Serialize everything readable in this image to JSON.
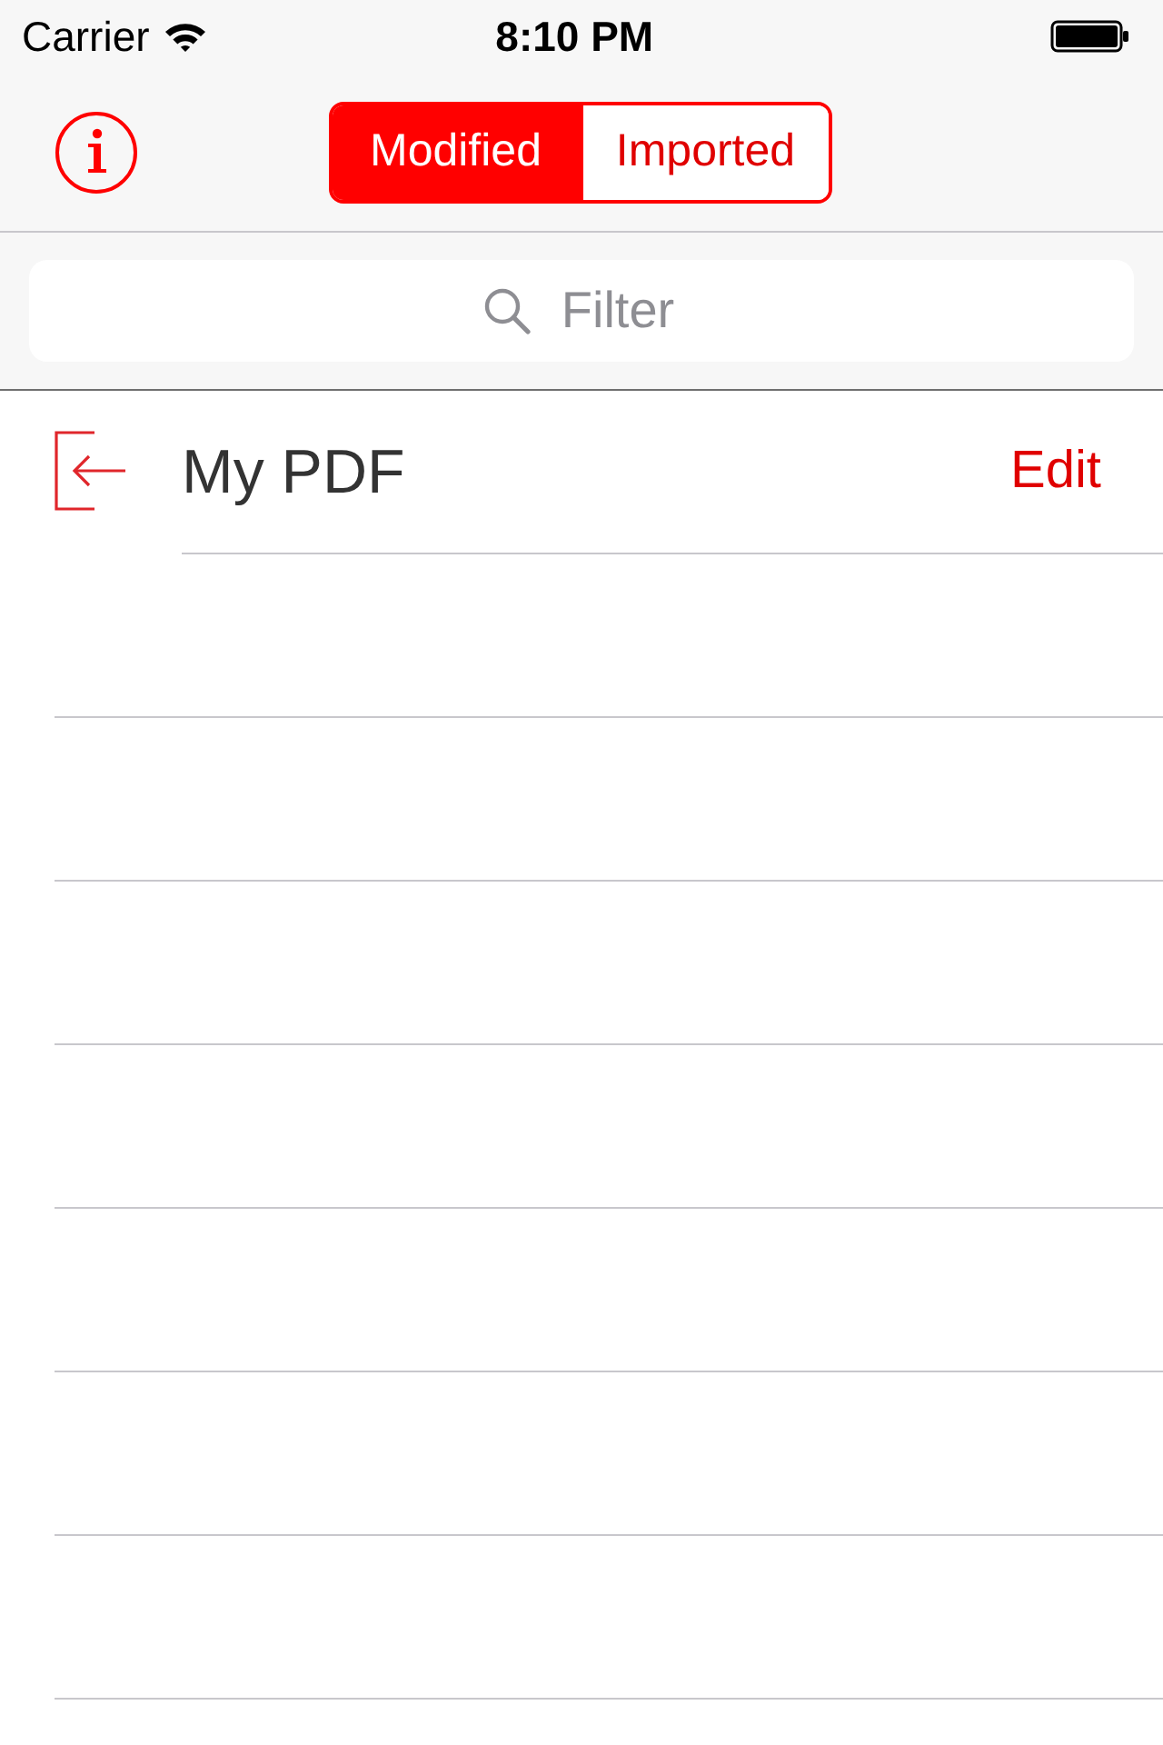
{
  "status_bar": {
    "carrier": "Carrier",
    "time": "8:10 PM"
  },
  "nav_bar": {
    "segments": [
      {
        "label": "Modified",
        "selected": true
      },
      {
        "label": "Imported",
        "selected": false
      }
    ]
  },
  "search": {
    "placeholder": "Filter"
  },
  "documents": [
    {
      "title": "My PDF",
      "action": "Edit"
    }
  ]
}
